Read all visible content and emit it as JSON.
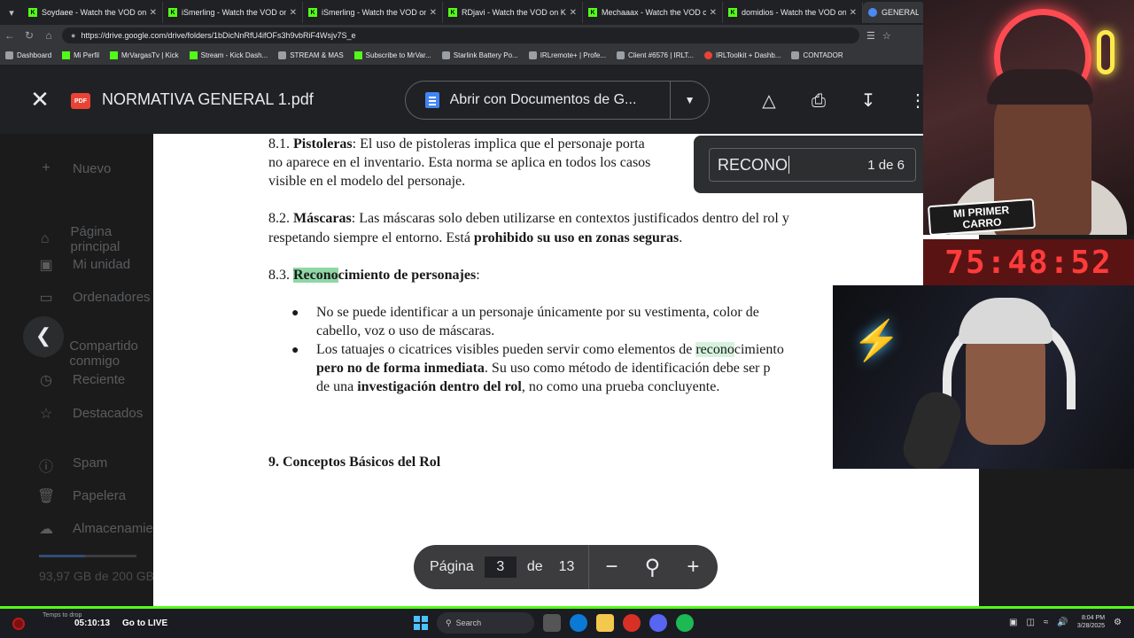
{
  "browser": {
    "tabs": [
      {
        "label": "Soydaee - Watch the VOD on Kick"
      },
      {
        "label": "iSmerling - Watch the VOD on Kick"
      },
      {
        "label": "iSmerling - Watch the VOD on Kick"
      },
      {
        "label": "RDjavi - Watch the VOD on Kick"
      },
      {
        "label": "Mechaaax - Watch the VOD on Kick"
      },
      {
        "label": "domidios - Watch the VOD on Kick"
      },
      {
        "label": "GENERAL - G"
      }
    ],
    "url": "https://drive.google.com/drive/folders/1bDicNnRfU4ifOFs3h9vbRiF4Wsjv7S_e",
    "bookmarks": [
      {
        "label": "Dashboard",
        "icon": "grey"
      },
      {
        "label": "Mi Perfil",
        "icon": "kick"
      },
      {
        "label": "MrVargasTv | Kick",
        "icon": "kick"
      },
      {
        "label": "Stream - Kick Dash...",
        "icon": "kick"
      },
      {
        "label": "STREAM & MAS",
        "icon": "grey"
      },
      {
        "label": "Subscribe to MrVar...",
        "icon": "kick"
      },
      {
        "label": "Starlink Battery Po...",
        "icon": "grey"
      },
      {
        "label": "IRLremote+ | Profe...",
        "icon": "grey"
      },
      {
        "label": "Client #6576 | IRLT...",
        "icon": "grey"
      },
      {
        "label": "IRLToolkit + Dashb...",
        "icon": "red"
      },
      {
        "label": "CONTADOR",
        "icon": "grey"
      }
    ]
  },
  "viewer": {
    "file_name": "NORMATIVA GENERAL 1.pdf",
    "pdf_badge": "PDF",
    "open_with": "Abrir con Documentos de G...",
    "search_query": "RECONO",
    "search_count": "1 de 6"
  },
  "drive_sidebar": {
    "new_button": "Nuevo",
    "items": [
      "Página principal",
      "Mi unidad",
      "Ordenadores",
      "Compartido conmigo",
      "Reciente",
      "Destacados",
      "Spam",
      "Papelera",
      "Almacenamiento"
    ],
    "storage": "93,97 GB de 200 GB",
    "storage_fraction": 0.47
  },
  "document": {
    "s81_num": "8.1.",
    "s81_title": "Pistoleras",
    "s81_line1_rest": ": El uso de pistoleras implica que el personaje porta",
    "s81_line2": "no aparece en el inventario. Esta norma se aplica en todos los casos",
    "s81_line3": "visible en el modelo del personaje.",
    "s82_num": "8.2.",
    "s82_title": "Máscaras",
    "s82_line1_rest": ": Las máscaras solo deben utilizarse en contextos justificados dentro del rol y",
    "s82_line2_pre": "respetando siempre el entorno. Está ",
    "s82_line2_bold": "prohibido su uso en zonas seguras",
    "s82_line2_end": ".",
    "s83_num": "8.3.",
    "s83_hl": "Recono",
    "s83_title_rest": "cimiento de personajes",
    "s83_colon": ":",
    "b1_line1": "No se puede identificar a un personaje únicamente por su vestimenta, color de",
    "b1_line2": "cabello, voz o uso de máscaras.",
    "b2_line1_pre": "Los tatuajes o cicatrices visibles pueden servir como elementos de ",
    "b2_line1_hl": "recono",
    "b2_line1_rest": "cimiento",
    "b2_line2_bold": "pero no de forma inmediata",
    "b2_line2_rest": ". Su uso como método de identificación debe ser p",
    "b2_line3_pre": "de una ",
    "b2_line3_bold": "investigación dentro del rol",
    "b2_line3_rest": ", no como una prueba concluyente.",
    "s9_title": "9. Conceptos Básicos del Rol"
  },
  "pager": {
    "label": "Página",
    "current": "3",
    "of": "de",
    "total": "13"
  },
  "overlay": {
    "timer": "75:48:52",
    "sticker_line1": "MI PRIMER",
    "sticker_line2": "CARRO"
  },
  "taskbar": {
    "rec_label": "Temps to drop",
    "stream_time": "05:10:13",
    "go_live": "Go to LIVE",
    "search_placeholder": "Search",
    "clock_time": "8:04 PM",
    "clock_date": "3/28/2025"
  }
}
